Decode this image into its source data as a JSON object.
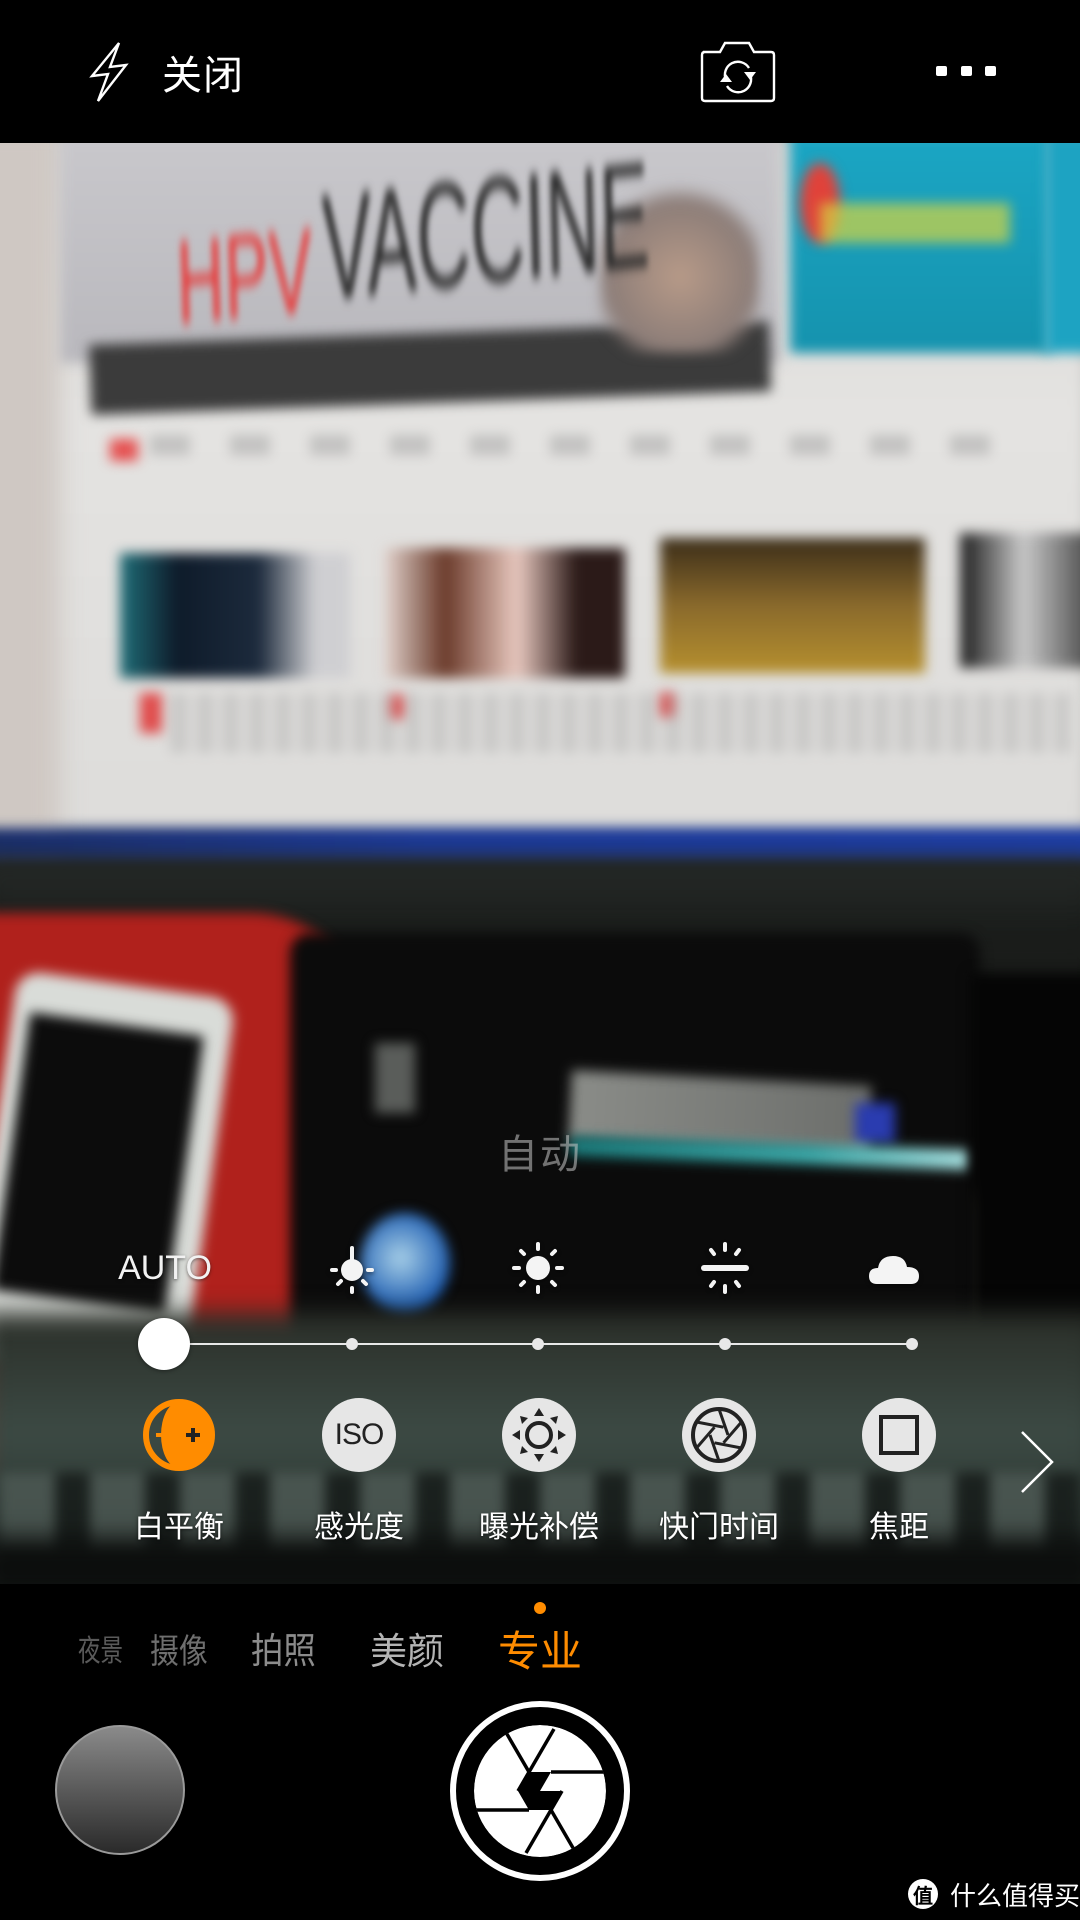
{
  "topbar": {
    "flash": {
      "icon": "flash-icon",
      "label": "关闭"
    },
    "switch_camera_icon": "camera-switch-icon",
    "more_icon": "more-dots-icon"
  },
  "viewfinder": {
    "focus_mode_hint": "自动"
  },
  "white_balance": {
    "presets": [
      {
        "label": "AUTO",
        "icon": null
      },
      {
        "label": "",
        "icon": "incandescent-icon"
      },
      {
        "label": "",
        "icon": "daylight-icon"
      },
      {
        "label": "",
        "icon": "fluorescent-icon"
      },
      {
        "label": "",
        "icon": "cloudy-icon"
      }
    ],
    "selected_index": 0
  },
  "pro_controls": {
    "items": [
      {
        "label": "白平衡",
        "icon": "white-balance-icon",
        "active": true
      },
      {
        "label": "感光度",
        "icon": "iso-icon",
        "icon_text": "ISO",
        "active": false
      },
      {
        "label": "曝光补偿",
        "icon": "exposure-icon",
        "active": false
      },
      {
        "label": "快门时间",
        "icon": "shutter-speed-icon",
        "active": false
      },
      {
        "label": "焦距",
        "icon": "focus-icon",
        "active": false
      }
    ],
    "next_icon": "chevron-right-icon"
  },
  "modes": {
    "items": [
      "夜景",
      "摄像",
      "拍照",
      "美颜",
      "专业"
    ],
    "selected": "专业"
  },
  "bottom": {
    "gallery_icon": "gallery-thumbnail",
    "shutter_icon": "aperture-icon"
  },
  "watermark": {
    "badge": "值",
    "text": "什么值得买"
  },
  "colors": {
    "accent": "#ff8c00",
    "icon_bg": "#e6e6e6",
    "background": "#000000"
  }
}
